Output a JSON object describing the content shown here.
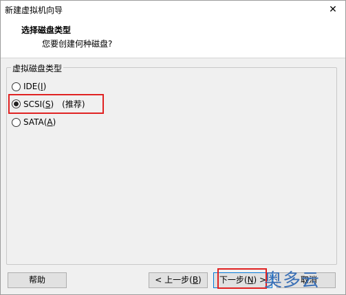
{
  "window": {
    "title": "新建虚拟机向导",
    "close_glyph": "✕"
  },
  "header": {
    "title": "选择磁盘类型",
    "subtitle": "您要创建何种磁盘?"
  },
  "group": {
    "label": "虚拟磁盘类型"
  },
  "options": {
    "ide": {
      "label_pre": "IDE(",
      "mnemonic": "I",
      "label_post": ")",
      "selected": false
    },
    "scsi": {
      "label_pre": "SCSI(",
      "mnemonic": "S",
      "label_post": ")",
      "note": "(推荐)",
      "selected": true
    },
    "sata": {
      "label_pre": "SATA(",
      "mnemonic": "A",
      "label_post": ")",
      "selected": false
    }
  },
  "buttons": {
    "help": "帮助",
    "back_pre": "< 上一步(",
    "back_mnemonic": "B",
    "back_post": ")",
    "next_pre": "下一步(",
    "next_mnemonic": "N",
    "next_post": ") >",
    "cancel": "取消"
  },
  "watermark": "奥多云",
  "accent_colors": {
    "highlight": "#e02020",
    "watermark": "#3a6fb5"
  }
}
